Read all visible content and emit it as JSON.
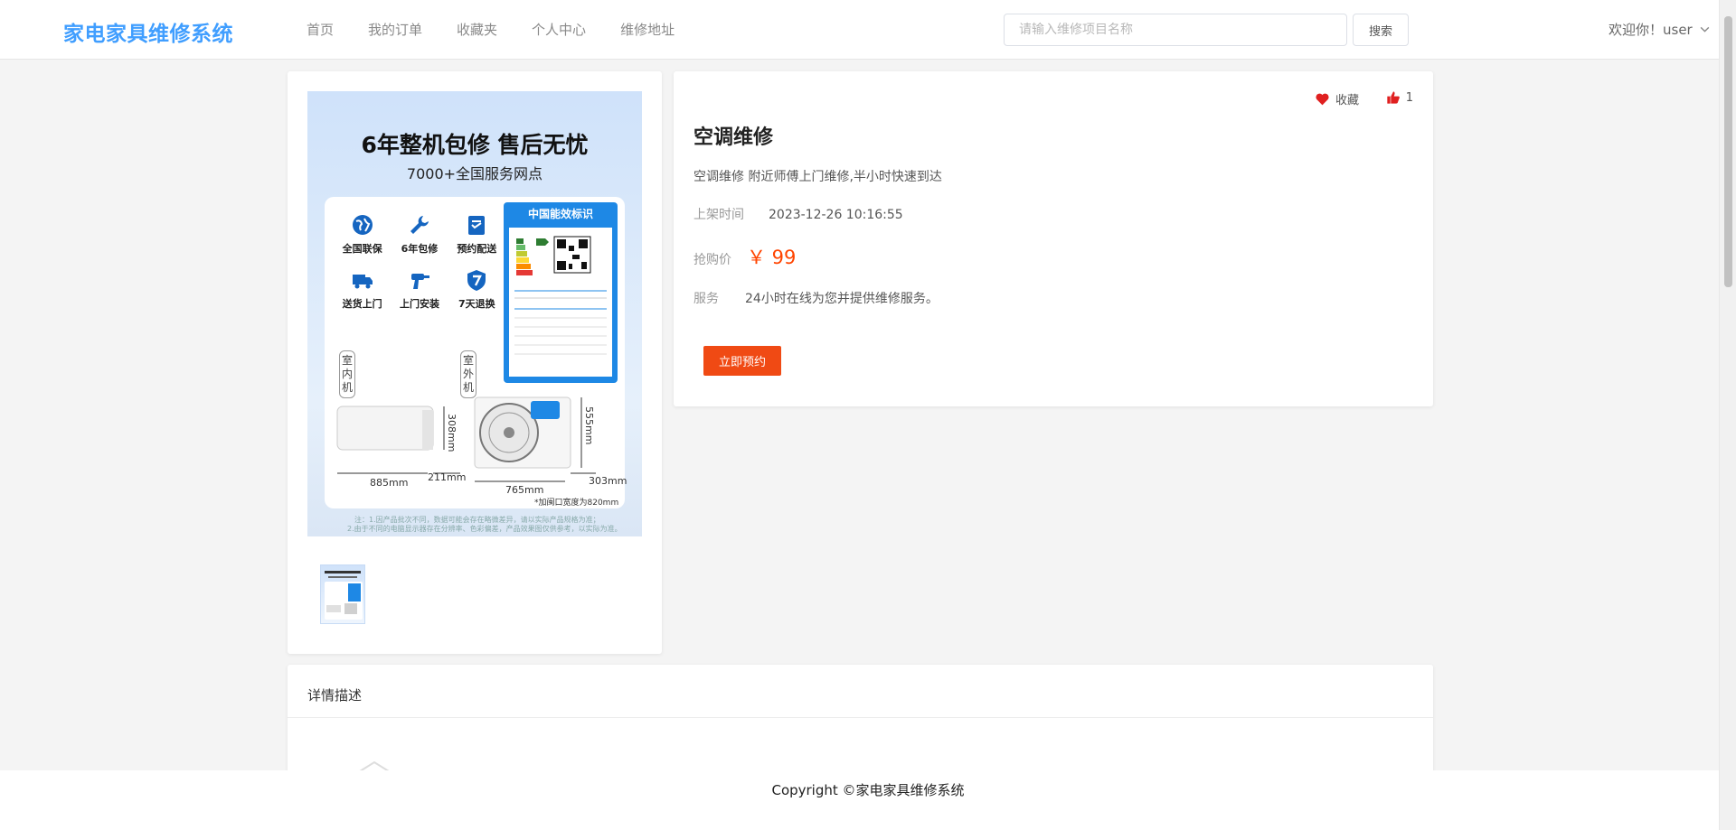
{
  "header": {
    "logo": "家电家具维修系统",
    "nav": [
      "首页",
      "我的订单",
      "收藏夹",
      "个人中心",
      "维修地址"
    ],
    "search": {
      "placeholder": "请输入维修项目名称",
      "value": ""
    },
    "search_button": "搜索",
    "user_greeting": "欢迎你！user"
  },
  "product_image": {
    "headline": "6年整机包修 售后无忧",
    "subline": "7000+全国服务网点",
    "features": [
      {
        "icon": "globe-icon",
        "label": "全国联保"
      },
      {
        "icon": "wrench-icon",
        "label": "6年包修"
      },
      {
        "icon": "checklist-icon",
        "label": "预约配送"
      },
      {
        "icon": "truck-icon",
        "label": "送货上门"
      },
      {
        "icon": "drill-icon",
        "label": "上门安装"
      },
      {
        "icon": "shield-7-icon",
        "label": "7天退换"
      }
    ],
    "energy_label_title": "中国能效标识",
    "indoor_tag": "室内机",
    "outdoor_tag": "室外机",
    "dims": {
      "indoor_width": "885mm",
      "indoor_depth": "211mm",
      "indoor_height": "308mm",
      "outdoor_width": "765mm",
      "outdoor_depth": "303mm",
      "outdoor_height": "555mm",
      "outdoor_note": "*加闽口宽度为820mm"
    },
    "footnote_1": "注：1.因产品批次不同，数据可能会存在略微差异，请以实际产品规格为准；",
    "footnote_2": "2.由于不同的电脑显示器存在分辨率、色彩偏差，产品效果图仅供参考，以实际为准。"
  },
  "product": {
    "favorite_label": "收藏",
    "like_count": "1",
    "title": "空调维修",
    "description": "空调维修 附近师傅上门维修,半小时快速到达",
    "listed_label": "上架时间",
    "listed_time": "2023-12-26 10:16:55",
    "price_label": "抢购价",
    "price": "￥ 99",
    "service_label": "服务",
    "service_text": "24小时在线为您并提供维修服务。",
    "book_button": "立即预约"
  },
  "details": {
    "title": "详情描述"
  },
  "footer": {
    "copyright": "Copyright ©家电家具维修系统"
  },
  "colors": {
    "brand": "#409eff",
    "price": "#ff4400",
    "book_button": "#f04a14",
    "heart": "#e02020",
    "like": "#e02020"
  }
}
